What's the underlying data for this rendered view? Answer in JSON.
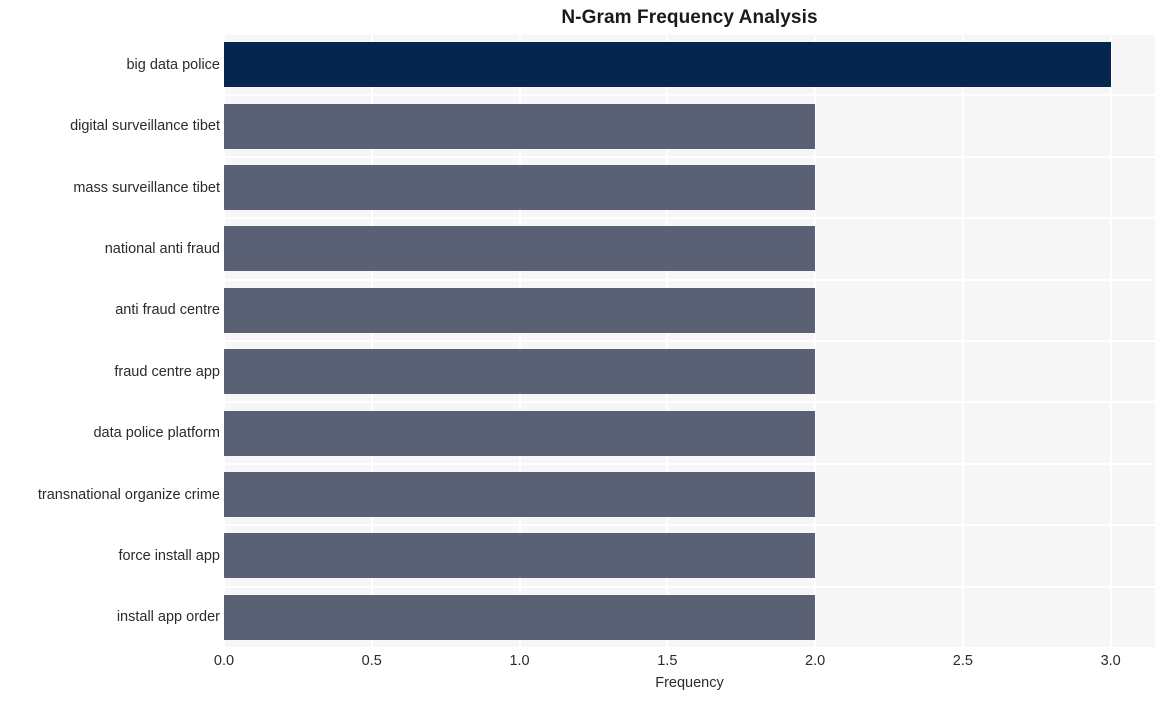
{
  "chart_data": {
    "type": "bar",
    "orientation": "horizontal",
    "title": "N-Gram Frequency Analysis",
    "xlabel": "Frequency",
    "ylabel": "",
    "xlim": [
      0,
      3.15
    ],
    "xticks": [
      "0.0",
      "0.5",
      "1.0",
      "1.5",
      "2.0",
      "2.5",
      "3.0"
    ],
    "xtick_values": [
      0.0,
      0.5,
      1.0,
      1.5,
      2.0,
      2.5,
      3.0
    ],
    "categories": [
      "big data police",
      "digital surveillance tibet",
      "mass surveillance tibet",
      "national anti fraud",
      "anti fraud centre",
      "fraud centre app",
      "data police platform",
      "transnational organize crime",
      "force install app",
      "install app order"
    ],
    "values": [
      3,
      2,
      2,
      2,
      2,
      2,
      2,
      2,
      2,
      2
    ],
    "bar_colors": [
      "#04264f",
      "#5a6174",
      "#5a6174",
      "#5a6174",
      "#5a6174",
      "#5a6174",
      "#5a6174",
      "#5a6174",
      "#5a6174",
      "#5a6174"
    ],
    "grid": true,
    "grid_color": "#ffffff",
    "plot_background": "#f6f6f7",
    "figure_background": "#ffffff",
    "legend": null,
    "legend_position": "none"
  }
}
